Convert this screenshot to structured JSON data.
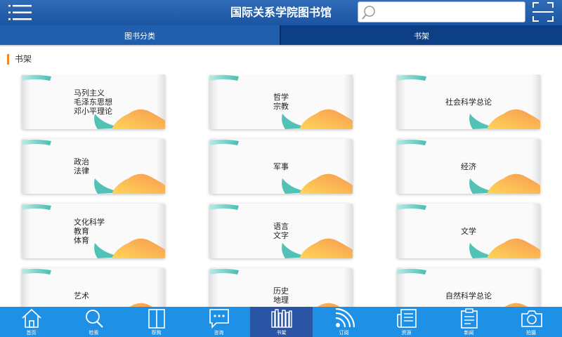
{
  "header": {
    "title": "国际关系学院图书馆",
    "search_placeholder": "",
    "menu_icon": "hamburger-icon",
    "scan_icon": "scan-icon"
  },
  "tabs": [
    {
      "label": "图书分类",
      "active": false
    },
    {
      "label": "书架",
      "active": true
    }
  ],
  "section_title": "书架",
  "shelves": [
    {
      "label": "马列主义\n毛泽东思想\n邓小平理论"
    },
    {
      "label": "哲学\n宗教"
    },
    {
      "label": "社会科学总论"
    },
    {
      "label": "政治\n法律"
    },
    {
      "label": "军事"
    },
    {
      "label": "经济"
    },
    {
      "label": "文化科学\n教育\n体育"
    },
    {
      "label": "语言\n文字"
    },
    {
      "label": "文学"
    },
    {
      "label": "艺术"
    },
    {
      "label": "历史\n地理"
    },
    {
      "label": "自然科学总论"
    }
  ],
  "bottom_nav": [
    {
      "label": "首页",
      "icon": "home-icon",
      "active": false
    },
    {
      "label": "检索",
      "icon": "search-icon",
      "active": false
    },
    {
      "label": "荐购",
      "icon": "book-icon",
      "active": false
    },
    {
      "label": "咨询",
      "icon": "chat-icon",
      "active": false
    },
    {
      "label": "书架",
      "icon": "bookshelf-icon",
      "active": true
    },
    {
      "label": "订阅",
      "icon": "rss-icon",
      "active": false
    },
    {
      "label": "资源",
      "icon": "newspaper-icon",
      "active": false
    },
    {
      "label": "新闻",
      "icon": "clipboard-icon",
      "active": false
    },
    {
      "label": "拍摄",
      "icon": "camera-icon",
      "active": false
    }
  ],
  "colors": {
    "header_bg": "#1c55a2",
    "tab_active_bg": "#0d3f86",
    "tab_inactive_bg": "#1f5fae",
    "accent_orange": "#f08a1c",
    "teal": "#4fc3b8",
    "bottom_nav_bg": "#1e90e6",
    "bottom_nav_active_bg": "#2a55a5"
  }
}
